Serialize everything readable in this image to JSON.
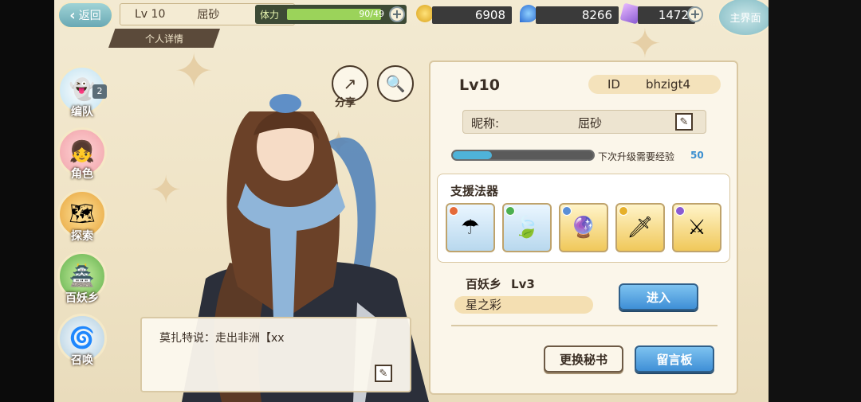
{
  "topbar": {
    "back_label": "返回",
    "level": "Lv 10",
    "player_name": "屈砂",
    "detail_tab": "个人详情",
    "stamina_label": "体力",
    "stamina_value": "90/49",
    "stamina_fraction": 1.0,
    "gold": "6908",
    "crystal": "8266",
    "gem": "1472",
    "main_label": "主界面"
  },
  "nav": [
    {
      "label": "编队",
      "badge": "2",
      "icon": "team-icon"
    },
    {
      "label": "角色",
      "icon": "character-icon"
    },
    {
      "label": "探索",
      "icon": "explore-icon"
    },
    {
      "label": "百妖乡",
      "icon": "village-icon"
    },
    {
      "label": "召唤",
      "icon": "summon-icon"
    }
  ],
  "actions": {
    "share_label": "分享"
  },
  "speech": {
    "text": "莫扎特说：走出非洲【xx"
  },
  "panel": {
    "level": "Lv10",
    "id_label": "ID",
    "id_value": "bhzigt4",
    "nick_label": "昵称:",
    "nick_value": "屈砂",
    "exp_label": "下次升级需要经验",
    "exp_value": "50",
    "exp_fraction": 0.28,
    "support_title": "支援法器",
    "support_items": [
      {
        "name": "artifact-red",
        "color": "#e46a3a"
      },
      {
        "name": "artifact-green",
        "color": "#4caf50"
      },
      {
        "name": "artifact-blue",
        "color": "#5b8fd6"
      },
      {
        "name": "artifact-yellow",
        "color": "#e6b02a"
      },
      {
        "name": "artifact-purple",
        "color": "#8a5bd1"
      }
    ],
    "village_name": "百妖乡",
    "village_level": "Lv3",
    "village_title": "星之彩",
    "enter_label": "进入",
    "change_secretary_label": "更换秘书",
    "message_board_label": "留言板"
  }
}
